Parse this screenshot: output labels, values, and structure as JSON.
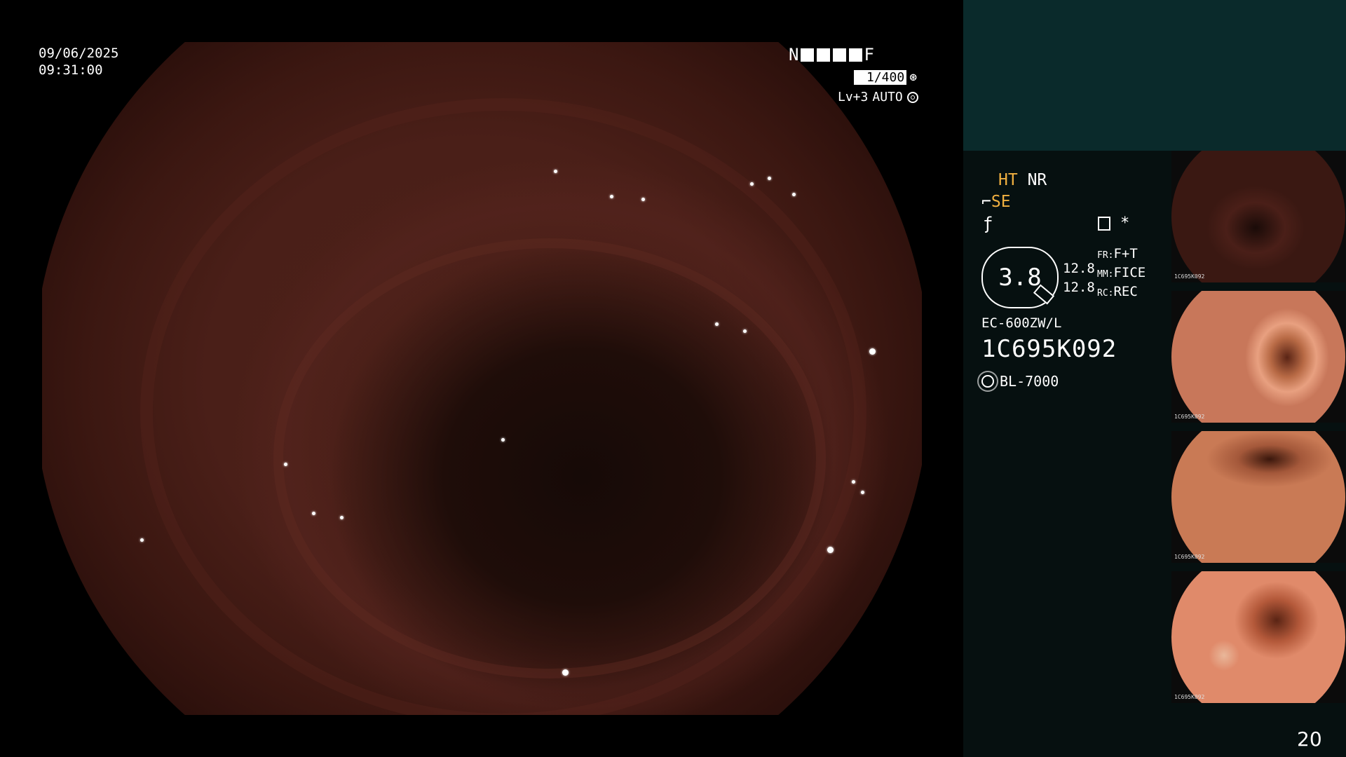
{
  "overlay": {
    "date": "09/06/2025",
    "time": "09:31:00",
    "near_label": "N",
    "far_label": "F",
    "shutter": "1/400",
    "level": "Lv+3",
    "iris_mode": "AUTO"
  },
  "panel": {
    "ht": "HT",
    "nr": "NR",
    "se": "SE",
    "zoom": "3.8",
    "zoom_values": [
      "12.8",
      "12.8"
    ],
    "fr_key": "FR:",
    "fr_val": "F+T",
    "mm_key": "MM:",
    "mm_val": "FICE",
    "rc_key": "RC:",
    "rc_val": "REC",
    "scope_model": "EC-600ZW/L",
    "serial": "1C695K092",
    "light_source": "BL-7000",
    "star": "*",
    "page_number": "20"
  },
  "thumbnails": [
    {
      "label": "1C695K092"
    },
    {
      "label": "1C695K092"
    },
    {
      "label": "1C695K092"
    },
    {
      "label": "1C695K092"
    }
  ],
  "colors": {
    "panel_bg": "#061010",
    "panel_top": "#0a2a2b",
    "amber": "#f0b040"
  }
}
